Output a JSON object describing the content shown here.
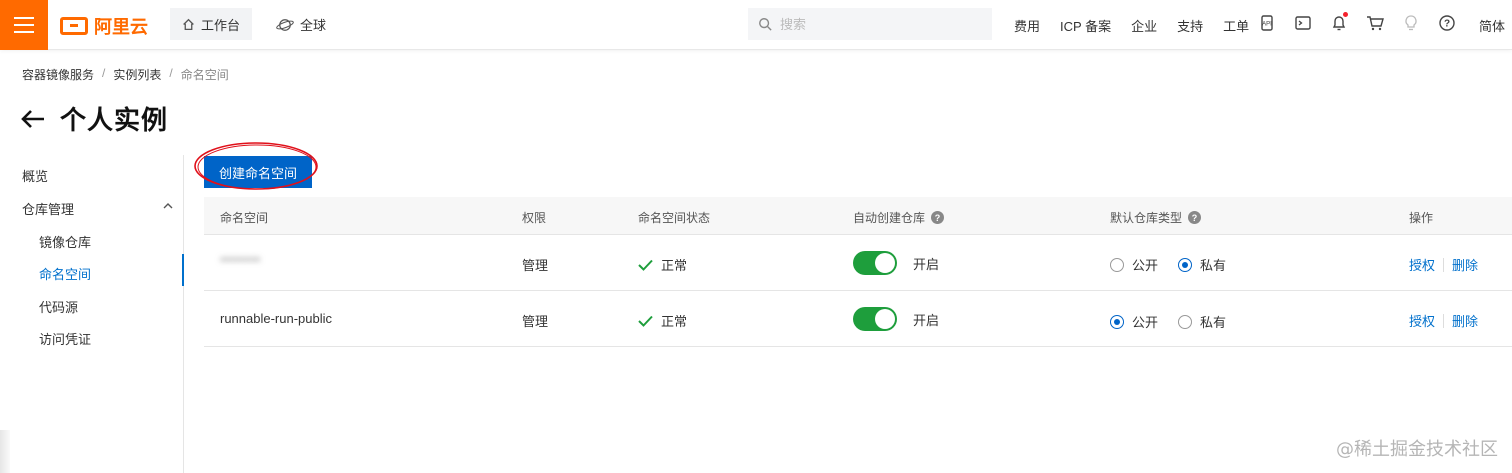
{
  "topbar": {
    "logo_text": "阿里云",
    "workbench_label": "工作台",
    "global_label": "全球",
    "search_placeholder": "搜索",
    "nav": [
      "费用",
      "ICP 备案",
      "企业",
      "支持",
      "工单"
    ],
    "lang": "简体",
    "brand_color": "#ff6a00"
  },
  "breadcrumb": {
    "items": [
      "容器镜像服务",
      "实例列表",
      "命名空间"
    ],
    "separator": "/"
  },
  "page": {
    "title": "个人实例"
  },
  "sidebar": {
    "items": [
      {
        "label": "概览"
      },
      {
        "label": "仓库管理"
      },
      {
        "label": "镜像仓库"
      },
      {
        "label": "命名空间"
      },
      {
        "label": "代码源"
      },
      {
        "label": "访问凭证"
      }
    ],
    "active": "命名空间"
  },
  "main": {
    "create_button": "创建命名空间",
    "columns": [
      "命名空间",
      "权限",
      "命名空间状态",
      "自动创建仓库",
      "默认仓库类型",
      "操作"
    ],
    "rows": [
      {
        "namespace": "********",
        "permission": "管理",
        "status": "正常",
        "auto_create": "开启",
        "auto_create_on": true,
        "repo_type_public": "公开",
        "repo_type_private": "私有",
        "selected": "私有",
        "action_grant": "授权",
        "action_delete": "删除"
      },
      {
        "namespace": "runnable-run-public",
        "permission": "管理",
        "status": "正常",
        "auto_create": "开启",
        "auto_create_on": true,
        "repo_type_public": "公开",
        "repo_type_private": "私有",
        "selected": "公开",
        "action_grant": "授权",
        "action_delete": "删除"
      }
    ],
    "accent_color": "#0064c8",
    "toggle_color": "#1e9e3c"
  },
  "watermark": "@稀土掘金技术社区"
}
